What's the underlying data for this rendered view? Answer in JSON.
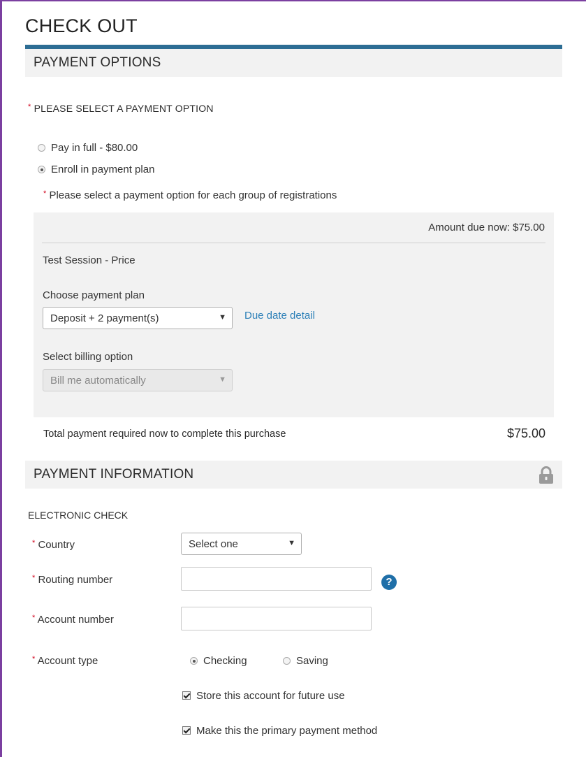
{
  "page": {
    "title": "CHECK OUT"
  },
  "payment_options": {
    "heading": "PAYMENT OPTIONS",
    "prompt": "PLEASE SELECT A PAYMENT OPTION",
    "required_mark": "*",
    "options": [
      {
        "label": "Pay in full - $80.00",
        "selected": false
      },
      {
        "label": "Enroll in payment plan",
        "selected": true
      }
    ],
    "group_note": "Please select a payment option for each group of registrations",
    "plan": {
      "amount_due": "Amount due now: $75.00",
      "session_name": "Test Session - Price",
      "choose_plan_label": "Choose payment plan",
      "plan_value": "Deposit + 2 payment(s)",
      "due_date_link": "Due date detail",
      "billing_label": "Select billing option",
      "billing_value": "Bill me automatically"
    },
    "total_label": "Total payment required now to complete this purchase",
    "total_value": "$75.00"
  },
  "payment_information": {
    "heading": "PAYMENT INFORMATION",
    "method": "ELECTRONIC CHECK",
    "country_label": "Country",
    "country_value": "Select one",
    "routing_label": "Routing number",
    "routing_value": "",
    "account_label": "Account number",
    "account_value": "",
    "account_type_label": "Account type",
    "account_types": [
      {
        "label": "Checking",
        "selected": true
      },
      {
        "label": "Saving",
        "selected": false
      }
    ],
    "store_account_label": "Store this account for future use",
    "store_account_checked": true,
    "primary_label": "Make this the primary payment method",
    "primary_checked": true,
    "help_glyph": "?"
  },
  "colors": {
    "accent_bar": "#2d6d94",
    "link": "#2d80b8",
    "required": "#d0021b",
    "frame": "#7b3fa0"
  },
  "icons": {
    "lock": "lock-icon",
    "help": "help-icon",
    "caret": "caret-down-icon"
  }
}
